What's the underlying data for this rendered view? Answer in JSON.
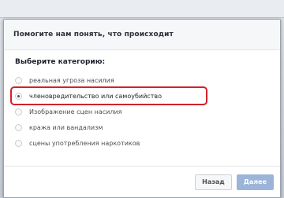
{
  "dialog": {
    "title": "Помогите нам понять, что происходит",
    "prompt": "Выберите категорию:",
    "options": [
      {
        "label": "реальная угроза насилия",
        "selected": false
      },
      {
        "label": "членовредительство или самоубийство",
        "selected": true
      },
      {
        "label": "Изображение сцен насилия",
        "selected": false
      },
      {
        "label": "кража или вандализм",
        "selected": false
      },
      {
        "label": "сцены употребления наркотиков",
        "selected": false
      }
    ],
    "back_label": "Назад",
    "next_label": "Далее"
  },
  "colors": {
    "highlight": "#d4202a",
    "next_button": "#9cb4d8"
  }
}
